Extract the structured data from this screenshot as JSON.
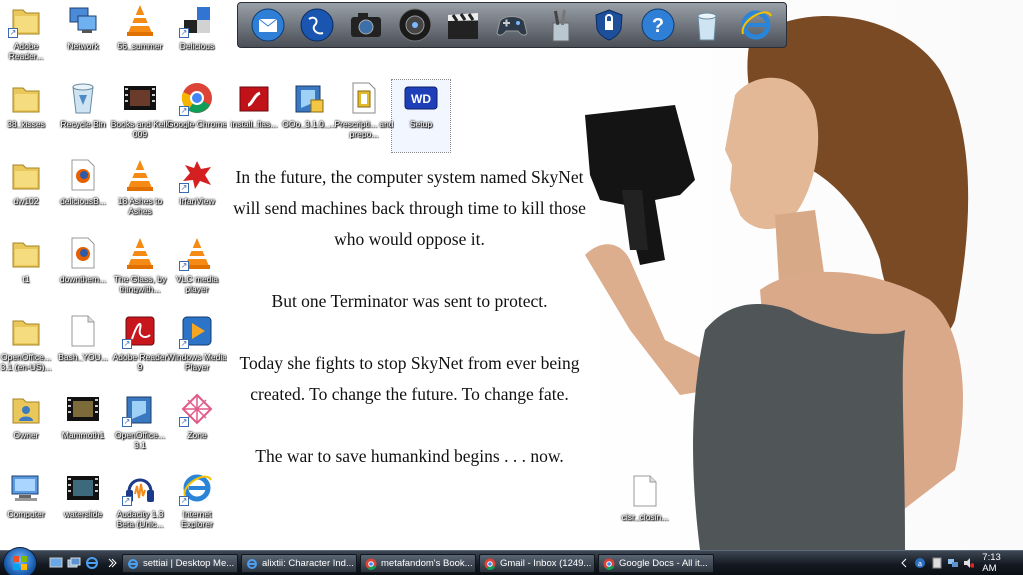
{
  "wallpaper": {
    "quote": [
      "In the future, the computer system named SkyNet will send machines back through time to kill those who would oppose it.",
      "But one Terminator was sent to protect.",
      "Today she fights to stop SkyNet from ever being created. To change the future. To change fate.",
      "The war to save humankind begins . . . now."
    ]
  },
  "desktop_icons": [
    {
      "label": "Adobe Reader...",
      "icon": "folder-icon"
    },
    {
      "label": "Network",
      "icon": "network-icon"
    },
    {
      "label": "56_summer",
      "icon": "vlc-icon"
    },
    {
      "label": "Delicious",
      "icon": "delicious-icon"
    },
    {
      "label": "38_kisses",
      "icon": "folder-icon"
    },
    {
      "label": "Recycle Bin",
      "icon": "recycle-bin-icon"
    },
    {
      "label": "Books and Kelli 009",
      "icon": "video-file-icon"
    },
    {
      "label": "Google Chrome",
      "icon": "chrome-icon"
    },
    {
      "label": "install_flas...",
      "icon": "flash-installer-icon"
    },
    {
      "label": "OOo_3.1.0_...",
      "icon": "installer-icon"
    },
    {
      "label": "Prescripti... and prepo...",
      "icon": "document-icon"
    },
    {
      "label": "Setup",
      "icon": "wd-setup-icon"
    },
    {
      "label": "dw102",
      "icon": "folder-icon"
    },
    {
      "label": "deliciousB...",
      "icon": "firefox-file-icon"
    },
    {
      "label": "18 Ashes to Ashes",
      "icon": "vlc-icon"
    },
    {
      "label": "IrfanView",
      "icon": "irfanview-icon"
    },
    {
      "label": "t1",
      "icon": "folder-icon"
    },
    {
      "label": "downthem...",
      "icon": "firefox-file-icon"
    },
    {
      "label": "The Glass, by thingwith...",
      "icon": "vlc-icon"
    },
    {
      "label": "VLC media player",
      "icon": "vlc-icon"
    },
    {
      "label": "OpenOffice... 3.1 (en-US)...",
      "icon": "folder-icon"
    },
    {
      "label": "Bash_YOU...",
      "icon": "blank-file-icon"
    },
    {
      "label": "Adobe Reader 9",
      "icon": "adobe-reader-icon"
    },
    {
      "label": "Windows Media Player",
      "icon": "media-player-icon"
    },
    {
      "label": "Owner",
      "icon": "user-folder-icon"
    },
    {
      "label": "Mammoth1",
      "icon": "video-file-icon"
    },
    {
      "label": "OpenOffice... 3.1",
      "icon": "openoffice-icon"
    },
    {
      "label": "Zone",
      "icon": "zone-icon"
    },
    {
      "label": "Computer",
      "icon": "computer-icon"
    },
    {
      "label": "waterslide",
      "icon": "video-file-icon"
    },
    {
      "label": "Audacity 1.3 Beta (Unic...",
      "icon": "audacity-icon"
    },
    {
      "label": "Internet Explorer",
      "icon": "ie-icon"
    },
    {
      "label": "cisr_closin...",
      "icon": "blank-file-icon"
    }
  ],
  "dock": [
    {
      "name": "mail-icon"
    },
    {
      "name": "globe-icon"
    },
    {
      "name": "camera-icon"
    },
    {
      "name": "speaker-icon"
    },
    {
      "name": "clapperboard-icon"
    },
    {
      "name": "gamepad-icon"
    },
    {
      "name": "pencil-cup-icon"
    },
    {
      "name": "security-shield-icon"
    },
    {
      "name": "help-icon"
    },
    {
      "name": "trash-icon"
    },
    {
      "name": "ie-icon"
    }
  ],
  "taskbar": {
    "tasks": [
      {
        "label": "settiai | Desktop Me...",
        "icon": "ie-icon"
      },
      {
        "label": "alixtii: Character Ind...",
        "icon": "ie-icon"
      },
      {
        "label": "metafandom's Book...",
        "icon": "chrome-icon"
      },
      {
        "label": "Gmail - Inbox (1249...",
        "icon": "chrome-icon"
      },
      {
        "label": "Google Docs - All it...",
        "icon": "chrome-icon"
      }
    ],
    "clock": "7:13 AM"
  },
  "colors": {
    "taskbar": "#151b23",
    "dock": "#4a4f57",
    "label_text": "#ffffff"
  }
}
